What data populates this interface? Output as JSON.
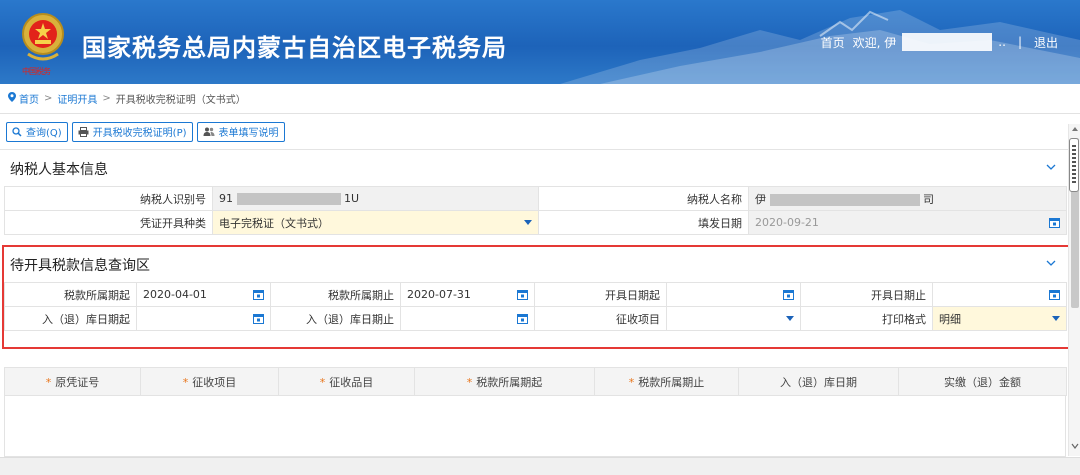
{
  "header": {
    "emblem_text": "中国税务",
    "title": "国家税务总局内蒙古自治区电子税务局",
    "home_link": "首页",
    "welcome": "欢迎, 伊",
    "welcome_tail": "..",
    "separator": "|",
    "logout": "退出"
  },
  "breadcrumb": {
    "home": "首页",
    "sep1": ">",
    "cert": "证明开具",
    "sep2": ">",
    "current": "开具税收完税证明（文书式）"
  },
  "toolbar": {
    "query": "查询(Q)",
    "issue": "开具税收完税证明(P)",
    "guide": "表单填写说明"
  },
  "taxpayer_section": {
    "title": "纳税人基本信息",
    "id_label": "纳税人识别号",
    "id_value_prefix": "91",
    "id_value_suffix": "1U",
    "name_label": "纳税人名称",
    "name_value_prefix": "伊",
    "name_value_suffix": "司",
    "voucher_type_label": "凭证开具种类",
    "voucher_type_value": "电子完税证（文书式）",
    "issue_date_label": "填发日期",
    "issue_date_value": "2020-09-21"
  },
  "query_section": {
    "title": "待开具税款信息查询区",
    "tax_period_start_label": "税款所属期起",
    "tax_period_start_value": "2020-04-01",
    "tax_period_end_label": "税款所属期止",
    "tax_period_end_value": "2020-07-31",
    "issue_date_start_label": "开具日期起",
    "issue_date_start_value": "",
    "issue_date_end_label": "开具日期止",
    "issue_date_end_value": "",
    "warehouse_date_start_label": "入（退）库日期起",
    "warehouse_date_start_value": "",
    "warehouse_date_end_label": "入（退）库日期止",
    "warehouse_date_end_value": "",
    "levy_item_label": "征收项目",
    "levy_item_value": "",
    "print_format_label": "打印格式",
    "print_format_value": "明细"
  },
  "results_table": {
    "columns": [
      {
        "label": "原凭证号",
        "required": true
      },
      {
        "label": "征收项目",
        "required": true
      },
      {
        "label": "征收品目",
        "required": true
      },
      {
        "label": "税款所属期起",
        "required": true
      },
      {
        "label": "税款所属期止",
        "required": true
      },
      {
        "label": "入（退）库日期",
        "required": false
      },
      {
        "label": "实缴（退）金额",
        "required": false
      }
    ],
    "required_mark": "*"
  },
  "colors": {
    "header_blue": "#1d63b9",
    "link_blue": "#1b78d3",
    "highlight_red": "#e53935",
    "required_orange": "#e8741a",
    "field_yellow": "#fff8dc"
  },
  "icons": [
    "emblem-icon",
    "location-pin-icon",
    "search-icon",
    "printer-icon",
    "users-icon",
    "chevron-down-icon",
    "calendar-icon",
    "dropdown-arrow-icon"
  ]
}
